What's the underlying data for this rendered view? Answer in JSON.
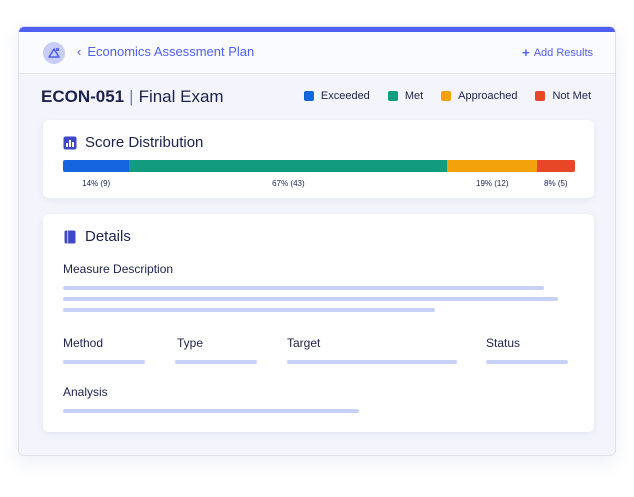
{
  "header": {
    "back_label": "Economics Assessment Plan",
    "add_results_label": "Add Results"
  },
  "exam": {
    "code": "ECON-051",
    "separator": "|",
    "name": "Final Exam"
  },
  "legend": [
    {
      "label": "Exceeded",
      "color": "#1565e0"
    },
    {
      "label": "Met",
      "color": "#139b7f"
    },
    {
      "label": "Approached",
      "color": "#f4a20c"
    },
    {
      "label": "Not Met",
      "color": "#e84727"
    }
  ],
  "score_distribution": {
    "title": "Score Distribution",
    "segments": [
      {
        "label": "Exceeded",
        "percent": 14,
        "count": 9,
        "display": "14% (9)",
        "color": "#1565e0"
      },
      {
        "label": "Met",
        "percent": 67,
        "count": 43,
        "display": "67% (43)",
        "color": "#139b7f"
      },
      {
        "label": "Approached",
        "percent": 19,
        "count": 12,
        "display": "19% (12)",
        "color": "#f4a20c"
      },
      {
        "label": "Not Met",
        "percent": 8,
        "count": 5,
        "display": "8% (5)",
        "color": "#e84727"
      }
    ]
  },
  "details": {
    "title": "Details",
    "measure_description_label": "Measure Description",
    "method_label": "Method",
    "type_label": "Type",
    "target_label": "Target",
    "status_label": "Status",
    "analysis_label": "Analysis"
  }
}
